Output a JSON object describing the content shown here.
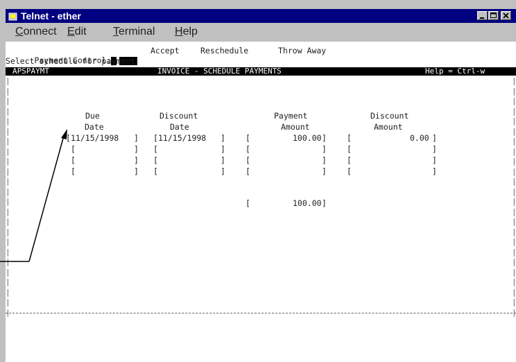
{
  "window": {
    "title": "Telnet - ether"
  },
  "menu": {
    "items": [
      {
        "label_u": "C",
        "label_rest": "onnect"
      },
      {
        "label_u": "E",
        "label_rest": "dit"
      },
      {
        "label_u": "T",
        "label_rest": "erminal"
      },
      {
        "label_u": "H",
        "label_rest": "elp"
      }
    ]
  },
  "terminal": {
    "control_label": "Payment Control:",
    "options": [
      "Accept",
      "Reschedule",
      "Throw Away"
    ],
    "prompt": "Select schedule for payment",
    "status_left": "APSPAYMT",
    "status_center": "INVOICE - SCHEDULE PAYMENTS",
    "status_right": "Help = Ctrl-w",
    "headers": {
      "due_date_1": "Due",
      "due_date_2": "Date",
      "discount_date_1": "Discount",
      "discount_date_2": "Date",
      "payment_amount_1": "Payment",
      "payment_amount_2": "Amount",
      "discount_amount_1": "Discount",
      "discount_amount_2": "Amount"
    },
    "rows": [
      {
        "due_date": "11/15/1998",
        "discount_date": "11/15/1998",
        "payment_amount": "100.00",
        "discount_amount": "0.00"
      },
      {
        "due_date": "",
        "discount_date": "",
        "payment_amount": "",
        "discount_amount": ""
      },
      {
        "due_date": "",
        "discount_date": "",
        "payment_amount": "",
        "discount_amount": ""
      },
      {
        "due_date": "",
        "discount_date": "",
        "payment_amount": "",
        "discount_amount": ""
      }
    ],
    "total_payment": "100.00"
  },
  "colors": {
    "title_bar": "#000080",
    "terminal_bg": "#ffffff",
    "status_bar": "#000000"
  }
}
